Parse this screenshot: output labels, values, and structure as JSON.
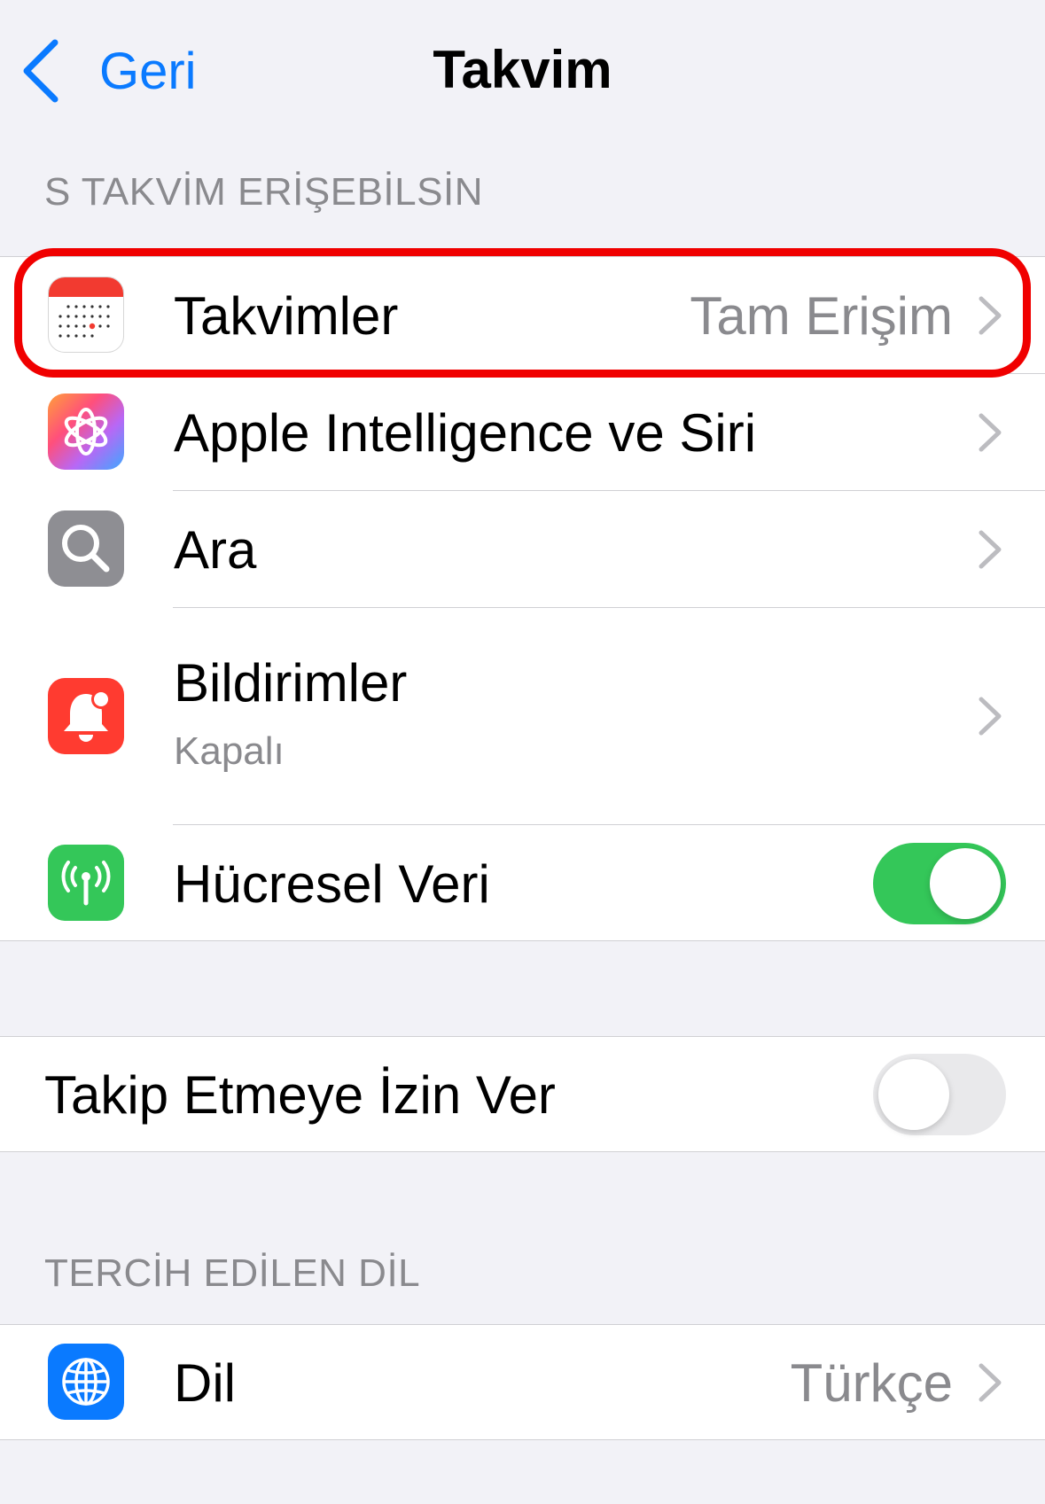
{
  "nav": {
    "back_label": "Geri",
    "title": "Takvim"
  },
  "sections": {
    "access_header": "S TAKVİM ERİŞEBİLSİN",
    "language_header": "TERCİH EDİLEN DİL"
  },
  "rows": {
    "calendars": {
      "label": "Takvimler",
      "value": "Tam Erişim"
    },
    "siri": {
      "label": "Apple Intelligence ve Siri"
    },
    "search": {
      "label": "Ara"
    },
    "notifications": {
      "label": "Bildirimler",
      "sublabel": "Kapalı"
    },
    "cellular": {
      "label": "Hücresel Veri",
      "enabled": true
    },
    "tracking": {
      "label": "Takip Etmeye İzin Ver",
      "enabled": false
    },
    "language": {
      "label": "Dil",
      "value": "Türkçe"
    }
  },
  "colors": {
    "accent": "#0A7AFF",
    "toggle_on": "#34C759",
    "highlight": "#F00000",
    "notifications_icon": "#FF3B30",
    "cellular_icon": "#34C759",
    "search_icon": "#8E8E93",
    "language_icon": "#0A7AFF"
  },
  "icons": {
    "back": "chevron-left-icon",
    "calendars": "calendar-icon",
    "siri": "apple-intelligence-icon",
    "search": "magnifier-icon",
    "notifications": "bell-icon",
    "cellular": "antenna-icon",
    "language": "globe-icon",
    "disclosure": "chevron-right-icon"
  }
}
